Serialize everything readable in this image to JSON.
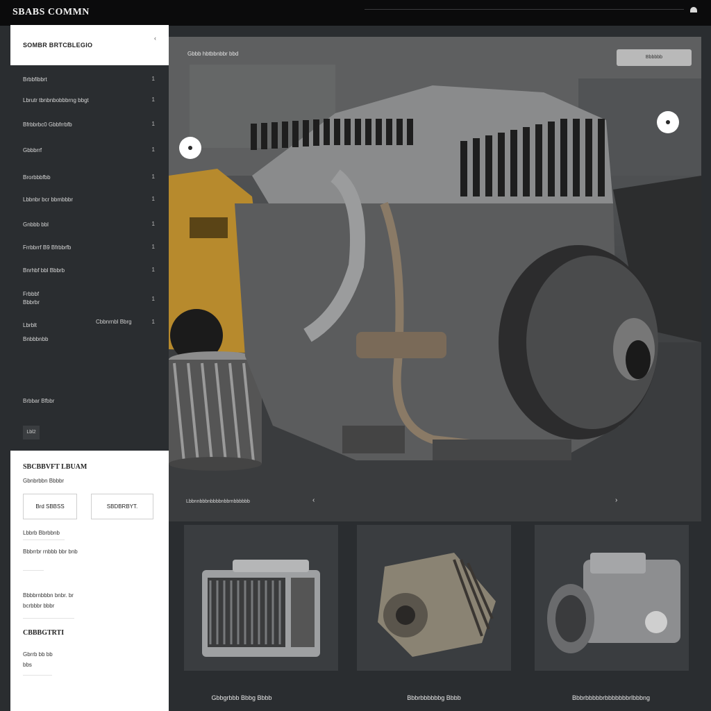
{
  "app": {
    "brand": "SBABS COMMN"
  },
  "sidebar": {
    "header_title": "SOMBR BRTCBLEGIO",
    "header_chevron": "‹",
    "items": [
      {
        "label": "Brbbfibbrt",
        "count": "1"
      },
      {
        "label": "Lbrutr tbnbnbobbbrng bbgt",
        "count": "1"
      },
      {
        "label": "Bfrbbrbc0 Gbbfrrbfb",
        "count": "1"
      },
      {
        "label": "Gbbbrrf",
        "count": "1"
      },
      {
        "label": "Brorbbbfbb",
        "count": "1"
      },
      {
        "label": "Lbbnbr bcr bbmbbbr",
        "count": "1"
      },
      {
        "label": "Gnbbb bbl",
        "count": "1"
      },
      {
        "label": "Frrbbrrf B9 Bfrbbrfb",
        "count": "1"
      },
      {
        "label": "Bnrhbf bbl Bbbrb",
        "count": "1"
      },
      {
        "label": "Frbbbf\nBbbrbr",
        "count": "1"
      },
      {
        "label": "Lbrblt\nBnbbbnbb",
        "count": "1",
        "extra": "Cbbnrnbl Bbrg"
      }
    ],
    "footer_text": "Brbbar Bfbbr",
    "footer_button": "Lbl2"
  },
  "panel": {
    "title": "SBCBBVFT LBUAM",
    "subtitle": "Gbnbrbbn Bbbbr",
    "btn1": "Brd SBBSS",
    "btn2": "SBDBRBYT.",
    "line1": "Lbbrb Bbrbbnb",
    "line2": "Bbbrrbr rnbbb bbr bnb",
    "line3": "Bbbbrnbbbn bnbr. br",
    "line4": "bcrbbbr bbbr",
    "section": "CBBBGTRTI",
    "line5": "Gbrrb bb bb",
    "line6": "bbs"
  },
  "hero": {
    "label": "Gbbb hbtbbnbbr bbd",
    "button": "Bbbbbb",
    "caption": "Lbbnnbbbnbbbbnbbrnbbbbbb",
    "marker1": "‹",
    "marker2": "›"
  },
  "cards": [
    {
      "caption": "Gbbgrbbb Bbbg Bbbb"
    },
    {
      "caption": "Bbbrbbbbbbg Bbbb"
    },
    {
      "caption": "Bbbrbbbbbrbbbbbbbrlbbbng"
    }
  ]
}
